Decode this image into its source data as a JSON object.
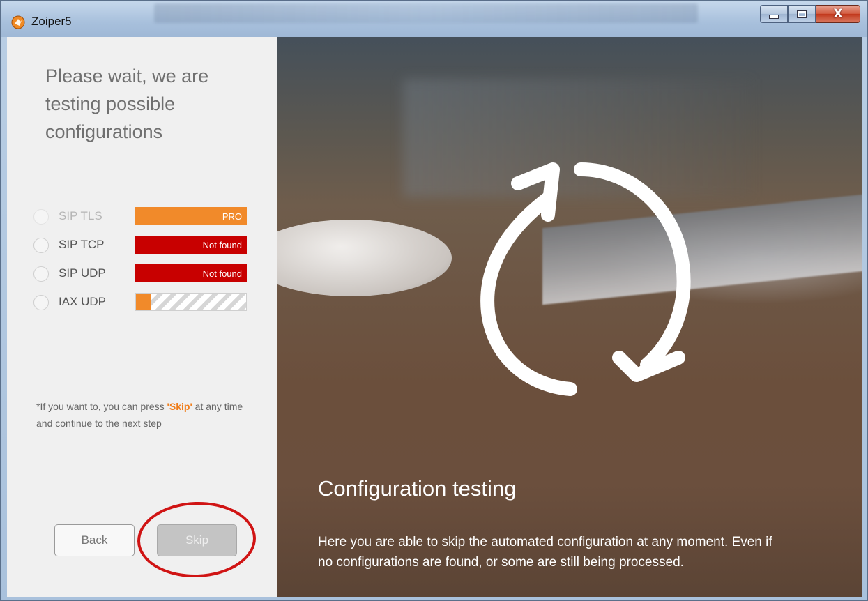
{
  "window": {
    "title": "Zoiper5",
    "icons": {
      "app": "zoiper-app-icon",
      "minimize": "minimize-icon",
      "maximize": "maximize-icon",
      "close": "close-icon"
    }
  },
  "left": {
    "heading_lines": [
      "Please wait, we are",
      "testing possible",
      "configurations"
    ],
    "protocols": [
      {
        "label": "SIP TLS",
        "status": "PRO",
        "state": "pro"
      },
      {
        "label": "SIP TCP",
        "status": "Not found",
        "state": "notfound"
      },
      {
        "label": "SIP UDP",
        "status": "Not found",
        "state": "notfound"
      },
      {
        "label": "IAX UDP",
        "status": "",
        "state": "testing",
        "progress": 0.14
      }
    ],
    "hint_prefix": "*If you want to, you can press ",
    "hint_skip": "'Skip'",
    "hint_suffix": " at any time and continue to the next step",
    "back_label": "Back",
    "skip_label": "Skip"
  },
  "right": {
    "icon": "refresh-cycle-icon",
    "title": "Configuration testing",
    "description": "Here you are able to skip the automated configuration at any moment. Even if no configurations are found, or some are still being processed."
  },
  "colors": {
    "accent": "#f18a2a",
    "error": "#c80000",
    "annotation": "#d01414"
  }
}
